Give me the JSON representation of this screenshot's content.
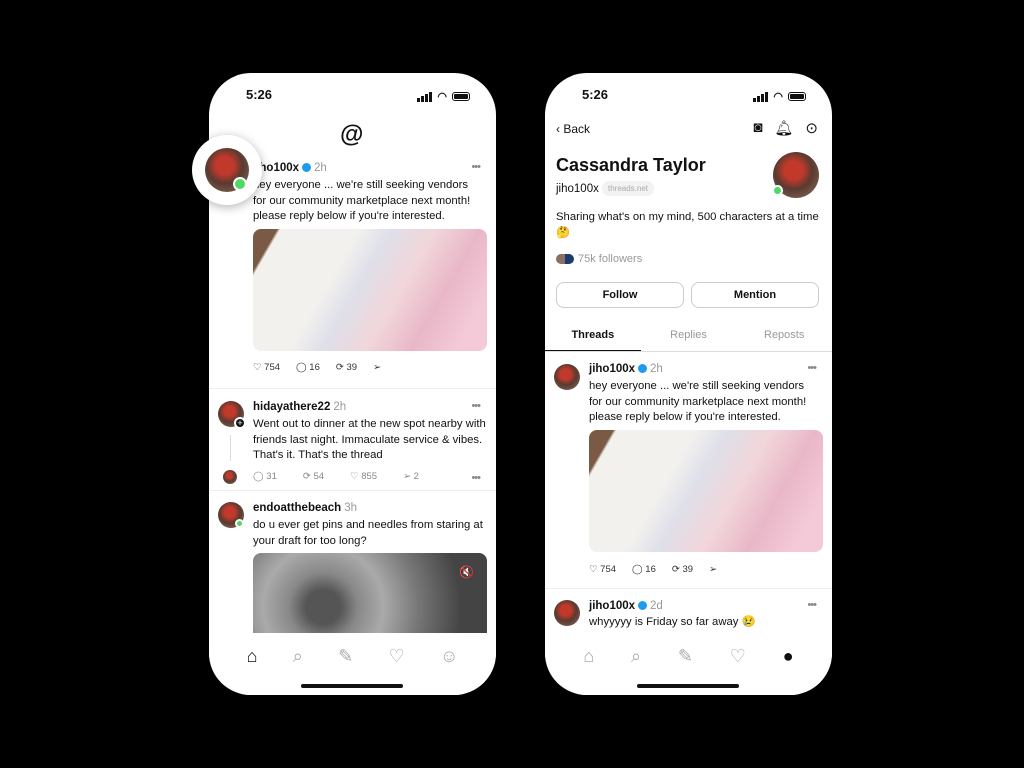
{
  "status": {
    "time": "5:26"
  },
  "feed": {
    "posts": [
      {
        "user": "jiho100x",
        "time": "2h",
        "text": "hey everyone ... we're still seeking vendors for our community marketplace next month! please reply below if you're interested.",
        "likes": "754",
        "replies": "16",
        "reposts": "39"
      },
      {
        "user": "hidayathere22",
        "time": "2h",
        "text": "Went out to dinner at the new spot nearby with friends last night. Immaculate service & vibes. That's it. That's the thread",
        "replies": "31",
        "reposts": "54",
        "likes": "855",
        "shares": "2"
      },
      {
        "user": "endoatthebeach",
        "time": "3h",
        "text": "do u ever get pins and needles from staring at your draft for too long?"
      }
    ]
  },
  "profile": {
    "back": "Back",
    "name": "Cassandra Taylor",
    "handle": "jiho100x",
    "domain": "threads.net",
    "bio": "Sharing what's on my mind, 500 characters at a time 🤔",
    "followers": "75k followers",
    "follow": "Follow",
    "mention": "Mention",
    "tabs": [
      "Threads",
      "Replies",
      "Reposts"
    ],
    "posts": [
      {
        "user": "jiho100x",
        "time": "2h",
        "text": "hey everyone ... we're still seeking vendors for our community marketplace next month! please reply below if you're interested.",
        "likes": "754",
        "replies": "16",
        "reposts": "39"
      },
      {
        "user": "jiho100x",
        "time": "2d",
        "text": "whyyyyy is Friday so far away 😢"
      }
    ]
  },
  "colors": {
    "verified": "#1d9bf0",
    "online": "#4cd964"
  }
}
